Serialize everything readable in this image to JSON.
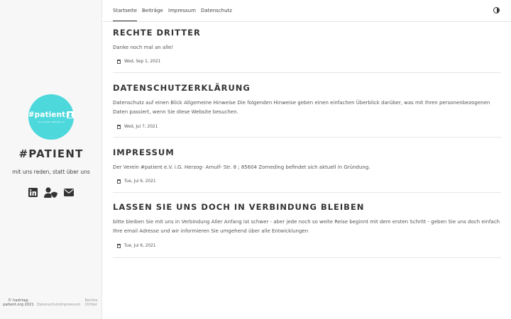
{
  "site": {
    "logo_text": "#patient",
    "logo_tagline": "mit uns reden, statt über uns",
    "title": "#PATIENT",
    "tagline": "mit uns reden, statt über uns",
    "brand_color": "#4dd8dc"
  },
  "social": [
    {
      "icon": "linkedin-icon"
    },
    {
      "icon": "user-shield-icon"
    },
    {
      "icon": "envelope-icon"
    }
  ],
  "footer": {
    "copyright": "© hashtag-patient.org 2021",
    "links": [
      "Datenschutz",
      "Impressum",
      "Rechte Dritter"
    ]
  },
  "nav": {
    "tabs": [
      "Startseite",
      "Beiträge",
      "Impressum",
      "Datenschutz"
    ],
    "active": "Startseite"
  },
  "posts": [
    {
      "title": "RECHTE DRITTER",
      "excerpt": "Danke noch mal an alle!",
      "date": "Wed, Sep 1, 2021"
    },
    {
      "title": "DATENSCHUTZERKLÄRUNG",
      "excerpt": "Datenschutz auf einen Blick Allgemeine Hinweise Die folgenden Hinweise geben einen einfachen Überblick darüber, was mit Ihren personenbezogenen Daten passiert, wenn Sie diese Website besuchen.",
      "date": "Wed, Jul 7, 2021"
    },
    {
      "title": "IMPRESSUM",
      "excerpt": "Der Verein #patient e.V. i.G. Herzog- Arnulf- Str. 8 ; 85604 Zorneding befindet sich aktuell in Gründung.",
      "date": "Tue, Jul 6, 2021"
    },
    {
      "title": "LASSEN SIE UNS DOCH IN VERBINDUNG BLEIBEN",
      "excerpt": "bitte bleiben Sie mit uns in Verbindung Aller Anfang ist schwer - aber jede noch so weite Reise beginnt mit dem ersten Schritt - geben Sie uns doch einfach Ihre email Adresse und wir informieren Sie umgehend über alle Entwicklungen",
      "date": "Tue, Jul 6, 2021"
    }
  ]
}
